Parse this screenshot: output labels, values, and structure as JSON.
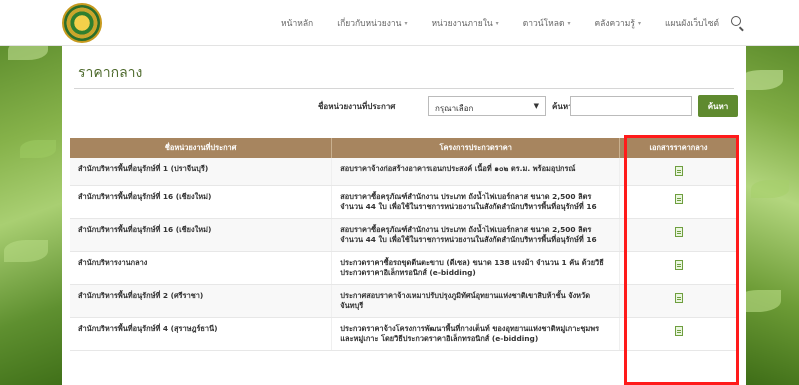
{
  "nav": {
    "items": [
      {
        "label": "หน้าหลัก",
        "has_caret": false
      },
      {
        "label": "เกี่ยวกับหน่วยงาน",
        "has_caret": true
      },
      {
        "label": "หน่วยงานภายใน",
        "has_caret": true
      },
      {
        "label": "ดาวน์โหลด",
        "has_caret": true
      },
      {
        "label": "คลังความรู้",
        "has_caret": true
      },
      {
        "label": "แผนผังเว็บไซต์",
        "has_caret": false
      }
    ],
    "search_icon": "search-icon"
  },
  "page": {
    "title": "ราคากลาง"
  },
  "filter": {
    "agency_label": "ชื่อหน่วยงานที่ประกาศ",
    "select_value": "กรุณาเลือก",
    "search_label": "ค้นหา",
    "search_placeholder": "",
    "button_label": "ค้นหา"
  },
  "table": {
    "headers": [
      "ชื่อหน่วยงานที่ประกาศ",
      "โครงการประกวดราคา",
      "เอกสารราคากลาง"
    ],
    "rows": [
      {
        "agency": "สำนักบริหารพื้นที่อนุรักษ์ที่ 1 (ปราจีนบุรี)",
        "project": "สอบราคาจ้างก่อสร้างอาคารเอนกประสงค์ เนื้อที่ ๑๐๒ ตร.ม. พร้อมอุปกรณ์"
      },
      {
        "agency": "สำนักบริหารพื้นที่อนุรักษ์ที่ 16 (เชียงใหม่)",
        "project": "สอบราคาซื้อครุภัณฑ์สำนักงาน ประเภท ถังน้ำไฟเบอร์กลาส ขนาด 2,500 ลิตร จำนวน 44 ใบ เพื่อใช้ในราชการหน่วยงานในสังกัดสำนักบริหารพื้นที่อนุรักษ์ที่ 16"
      },
      {
        "agency": "สำนักบริหารพื้นที่อนุรักษ์ที่ 16 (เชียงใหม่)",
        "project": "สอบราคาซื้อครุภัณฑ์สำนักงาน ประเภท ถังน้ำไฟเบอร์กลาส ขนาด 2,500 ลิตร จำนวน 44 ใบ เพื่อใช้ในราชการหน่วยงานในสังกัดสำนักบริหารพื้นที่อนุรักษ์ที่ 16"
      },
      {
        "agency": "สำนักบริหารงานกลาง",
        "project": "ประกวดราคาซื้อรถขุดตีนตะขาบ (ดีเซล) ขนาด 138 แรงม้า จำนวน 1 คัน ด้วยวิธีประกวดราคาอิเล็กทรอนิกส์ (e-bidding)"
      },
      {
        "agency": "สำนักบริหารพื้นที่อนุรักษ์ที่ 2 (ศรีราชา)",
        "project": "ประกาศสอบราคาจ้างเหมาปรับปรุงภูมิทัศน์อุทยานแห่งชาติเขาสิบห้าชั้น จังหวัดจันทบุรี"
      },
      {
        "agency": "สำนักบริหารพื้นที่อนุรักษ์ที่ 4 (สุราษฎร์ธานี)",
        "project": "ประกวดราคาจ้างโครงการพัฒนาพื้นที่กางเต็นท์ ของอุทยานแห่งชาติหมู่เกาะชุมพรและหมู่เกาะ โดยวิธีประกวดราคาอิเล็กทรอนิกส์ (e-bidding)"
      }
    ],
    "doc_icon": "document-icon"
  },
  "colors": {
    "header_bg": "#a7855f",
    "accent_green": "#5f8a2f",
    "highlight_red": "#ff1a1a"
  }
}
